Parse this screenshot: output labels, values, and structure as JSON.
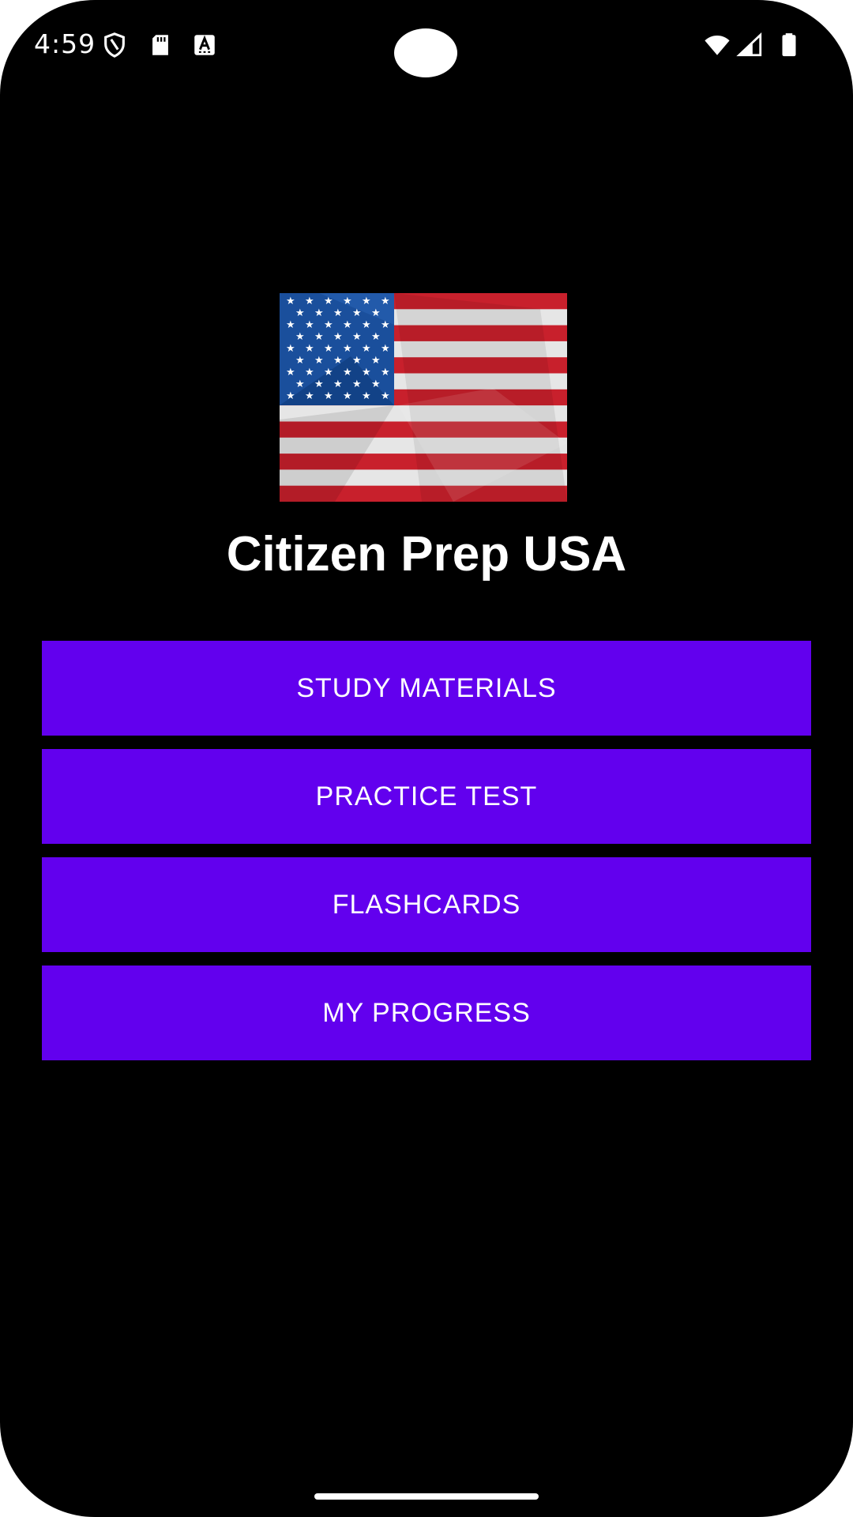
{
  "status_bar": {
    "time": "4:59",
    "left_icons": [
      "shield-icon",
      "sd-card-icon",
      "text-a-icon"
    ],
    "right_icons": [
      "wifi-icon",
      "cellular-signal-icon",
      "battery-icon"
    ]
  },
  "app": {
    "title": "Citizen Prep USA",
    "logo": "us-flag-icon"
  },
  "menu": {
    "buttons": [
      {
        "label": "STUDY MATERIALS"
      },
      {
        "label": "PRACTICE TEST"
      },
      {
        "label": "FLASHCARDS"
      },
      {
        "label": "MY PROGRESS"
      }
    ]
  },
  "colors": {
    "background": "#000000",
    "button": "#6200ee",
    "text": "#ffffff",
    "flag_red": "#c8202c",
    "flag_white": "#e6e6e6",
    "flag_blue": "#1a4f9c"
  }
}
